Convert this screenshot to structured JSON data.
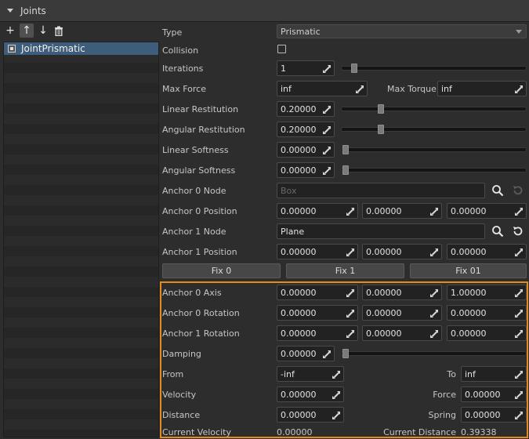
{
  "header": {
    "title": "Joints"
  },
  "toolbar": {
    "add": "+",
    "up": "↑",
    "down": "↓",
    "delete": "🗑"
  },
  "list": {
    "items": [
      {
        "label": "JointPrismatic"
      }
    ]
  },
  "props": {
    "type": {
      "label": "Type",
      "value": "Prismatic"
    },
    "collision": {
      "label": "Collision"
    },
    "iterations": {
      "label": "Iterations",
      "value": "1",
      "level": 0.05
    },
    "max_force": {
      "label": "Max Force",
      "value": "inf"
    },
    "max_torque": {
      "label": "Max Torque",
      "value": "inf"
    },
    "linear_restitution": {
      "label": "Linear Restitution",
      "value": "0.20000",
      "level": 0.2
    },
    "angular_restitution": {
      "label": "Angular Restitution",
      "value": "0.20000",
      "level": 0.2
    },
    "linear_softness": {
      "label": "Linear Softness",
      "value": "0.00000",
      "level": 0
    },
    "angular_softness": {
      "label": "Angular Softness",
      "value": "0.00000",
      "level": 0
    },
    "anchor0_node": {
      "label": "Anchor 0 Node",
      "value": "Box"
    },
    "anchor0_position": {
      "label": "Anchor 0 Position",
      "x": "0.00000",
      "y": "0.00000",
      "z": "0.00000"
    },
    "anchor1_node": {
      "label": "Anchor 1 Node",
      "value": "Plane"
    },
    "anchor1_position": {
      "label": "Anchor 1 Position",
      "x": "0.00000",
      "y": "0.00000",
      "z": "0.00000"
    },
    "fix_buttons": {
      "fix0": "Fix 0",
      "fix1": "Fix 1",
      "fix01": "Fix 01"
    },
    "anchor0_axis": {
      "label": "Anchor 0 Axis",
      "x": "0.00000",
      "y": "0.00000",
      "z": "1.00000"
    },
    "anchor0_rotation": {
      "label": "Anchor 0 Rotation",
      "x": "0.00000",
      "y": "0.00000",
      "z": "0.00000"
    },
    "anchor1_rotation": {
      "label": "Anchor 1 Rotation",
      "x": "0.00000",
      "y": "0.00000",
      "z": "0.00000"
    },
    "damping": {
      "label": "Damping",
      "value": "0.00000",
      "level": 0
    },
    "from": {
      "label": "From",
      "value": "-inf"
    },
    "to": {
      "label": "To",
      "value": "inf"
    },
    "velocity": {
      "label": "Velocity",
      "value": "0.00000"
    },
    "force": {
      "label": "Force",
      "value": "0.00000"
    },
    "distance": {
      "label": "Distance",
      "value": "0.00000"
    },
    "spring": {
      "label": "Spring",
      "value": "0.00000"
    },
    "current_velocity": {
      "label": "Current Velocity",
      "value": "0.00000"
    },
    "current_distance": {
      "label": "Current Distance",
      "value": "0.39338"
    }
  },
  "colors": {
    "highlight": "#e58b1c",
    "selection": "#3e5d7a"
  }
}
